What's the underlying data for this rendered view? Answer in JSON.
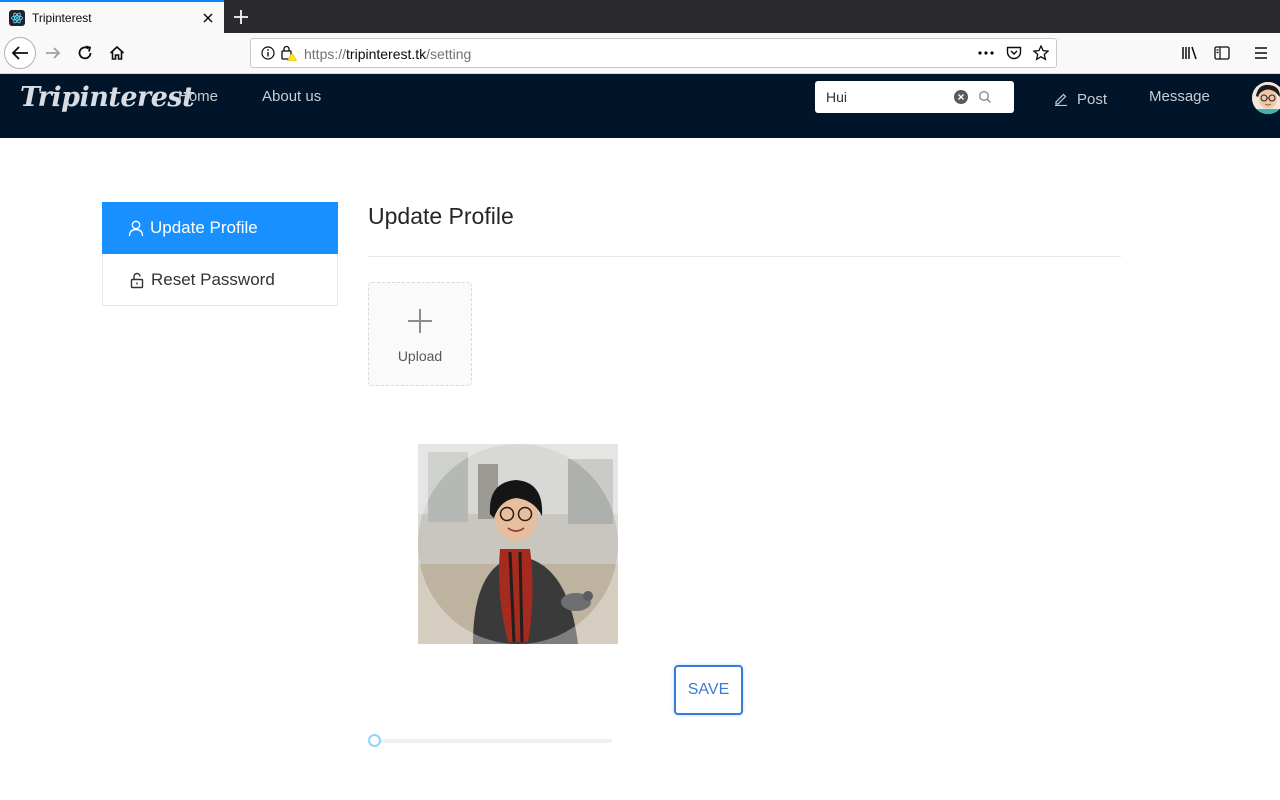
{
  "browser": {
    "tab_title": "Tripinterest",
    "url_scheme_host_prefix": "https://",
    "url_host": "tripinterest.tk",
    "url_path": "/setting"
  },
  "navbar": {
    "brand": "Tripinterest",
    "links": [
      "Home",
      "About us"
    ],
    "search_value": "Hui",
    "post_label": "Post",
    "message_label": "Message"
  },
  "sidebar": {
    "items": [
      {
        "label": "Update Profile",
        "icon": "user-icon",
        "active": true
      },
      {
        "label": "Reset Password",
        "icon": "unlock-icon",
        "active": false
      }
    ]
  },
  "main": {
    "title": "Update Profile",
    "upload_label": "Upload",
    "save_label": "SAVE",
    "zoom_slider_value": 0
  },
  "colors": {
    "navbar_bg": "#001529",
    "active_menu": "#1890ff",
    "save_border": "#3c7bd5"
  }
}
